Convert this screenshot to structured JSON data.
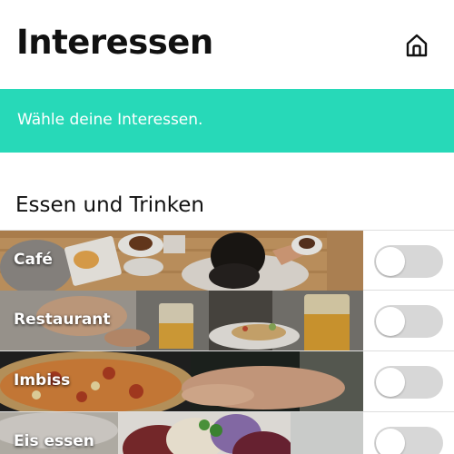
{
  "header": {
    "title": "Interessen",
    "home_icon": "home-icon"
  },
  "banner": {
    "text": "Wähle deine Interessen.",
    "color": "#27d9b8"
  },
  "section": {
    "title": "Essen und Trinken"
  },
  "interests": [
    {
      "label": "Café",
      "enabled": false,
      "image": "cafe-photo"
    },
    {
      "label": "Restaurant",
      "enabled": false,
      "image": "restaurant-photo"
    },
    {
      "label": "Imbiss",
      "enabled": false,
      "image": "imbiss-photo"
    },
    {
      "label": "Eis essen",
      "enabled": false,
      "image": "eis-photo"
    }
  ],
  "colors": {
    "accent": "#27d9b8",
    "toggle_off": "#d7d7d7"
  }
}
